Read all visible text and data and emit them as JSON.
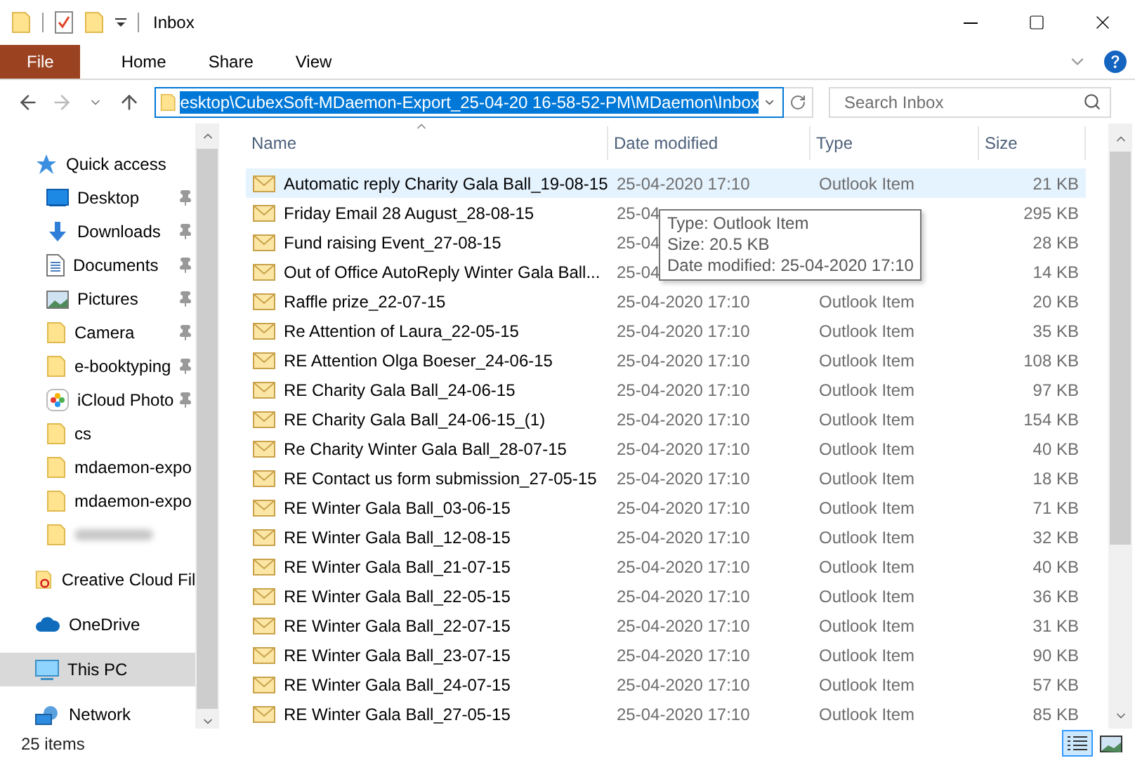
{
  "window": {
    "title": "Inbox"
  },
  "ribbon": {
    "tabs": [
      {
        "label": "File",
        "kind": "file",
        "selected": false
      },
      {
        "label": "Home",
        "kind": "tab",
        "selected": false
      },
      {
        "label": "Share",
        "kind": "tab",
        "selected": false
      },
      {
        "label": "View",
        "kind": "tab",
        "selected": false
      }
    ]
  },
  "address_bar": {
    "path": "esktop\\CubexSoft-MDaemon-Export_25-04-20 16-58-52-PM\\MDaemon\\Inbox",
    "text_selected": true
  },
  "search": {
    "placeholder": "Search Inbox"
  },
  "sidebar": {
    "items": [
      {
        "label": "Quick access",
        "kind": "star",
        "selected": false,
        "children": [
          {
            "label": "Desktop",
            "kind": "desktop",
            "pinned": true,
            "selected": false
          },
          {
            "label": "Downloads",
            "kind": "download",
            "pinned": true,
            "selected": false
          },
          {
            "label": "Documents",
            "kind": "document",
            "pinned": true,
            "selected": false
          },
          {
            "label": "Pictures",
            "kind": "pictures",
            "pinned": true,
            "selected": false
          },
          {
            "label": "Camera",
            "kind": "folder",
            "pinned": true,
            "selected": false
          },
          {
            "label": "e-booktyping",
            "kind": "folder",
            "pinned": true,
            "selected": false
          },
          {
            "label": "iCloud Photo",
            "kind": "photos",
            "pinned": true,
            "selected": false
          },
          {
            "label": "cs",
            "kind": "folder",
            "pinned": false,
            "selected": false
          },
          {
            "label": "mdaemon-expo",
            "kind": "folder",
            "pinned": false,
            "selected": false
          },
          {
            "label": "mdaemon-expo",
            "kind": "folder",
            "pinned": false,
            "selected": false
          },
          {
            "kind": "folder",
            "redacted": true,
            "pinned": false,
            "selected": false
          }
        ]
      },
      {
        "label": "Creative Cloud Fil",
        "kind": "creative",
        "selected": false
      },
      {
        "label": "OneDrive",
        "kind": "cloud",
        "selected": false
      },
      {
        "label": "This PC",
        "kind": "pc",
        "selected": true
      },
      {
        "label": "Network",
        "kind": "network",
        "selected": false
      }
    ]
  },
  "table": {
    "columns": [
      "Name",
      "Date modified",
      "Type",
      "Size"
    ],
    "rows": [
      {
        "name": "Automatic reply Charity Gala Ball_19-08-15",
        "date": "25-04-2020 17:10",
        "type": "Outlook Item",
        "size": "21 KB",
        "selected": true
      },
      {
        "name": "Friday Email 28 August_28-08-15",
        "date": "25-04",
        "size": "295 KB",
        "selected": false
      },
      {
        "name": "Fund raising Event_27-08-15",
        "date": "25-04",
        "size": "28 KB",
        "selected": false
      },
      {
        "name": "Out of Office AutoReply Winter Gala Ball...",
        "date": "25-04",
        "size": "14 KB",
        "selected": false
      },
      {
        "name": "Raffle prize_22-07-15",
        "date": "25-04-2020 17:10",
        "type": "Outlook Item",
        "size": "20 KB",
        "selected": false
      },
      {
        "name": "Re Attention of Laura_22-05-15",
        "date": "25-04-2020 17:10",
        "type": "Outlook Item",
        "size": "35 KB",
        "selected": false
      },
      {
        "name": "RE Attention Olga Boeser_24-06-15",
        "date": "25-04-2020 17:10",
        "type": "Outlook Item",
        "size": "108 KB",
        "selected": false
      },
      {
        "name": "RE Charity Gala Ball_24-06-15",
        "date": "25-04-2020 17:10",
        "type": "Outlook Item",
        "size": "97 KB",
        "selected": false
      },
      {
        "name": "RE Charity Gala Ball_24-06-15_(1)",
        "date": "25-04-2020 17:10",
        "type": "Outlook Item",
        "size": "154 KB",
        "selected": false
      },
      {
        "name": "Re Charity Winter Gala Ball_28-07-15",
        "date": "25-04-2020 17:10",
        "type": "Outlook Item",
        "size": "40 KB",
        "selected": false
      },
      {
        "name": "RE Contact us form submission_27-05-15",
        "date": "25-04-2020 17:10",
        "type": "Outlook Item",
        "size": "18 KB",
        "selected": false
      },
      {
        "name": "RE Winter Gala Ball_03-06-15",
        "date": "25-04-2020 17:10",
        "type": "Outlook Item",
        "size": "71 KB",
        "selected": false
      },
      {
        "name": "RE Winter Gala Ball_12-08-15",
        "date": "25-04-2020 17:10",
        "type": "Outlook Item",
        "size": "32 KB",
        "selected": false
      },
      {
        "name": "RE Winter Gala Ball_21-07-15",
        "date": "25-04-2020 17:10",
        "type": "Outlook Item",
        "size": "40 KB",
        "selected": false
      },
      {
        "name": "RE Winter Gala Ball_22-05-15",
        "date": "25-04-2020 17:10",
        "type": "Outlook Item",
        "size": "36 KB",
        "selected": false
      },
      {
        "name": "RE Winter Gala Ball_22-07-15",
        "date": "25-04-2020 17:10",
        "type": "Outlook Item",
        "size": "31 KB",
        "selected": false
      },
      {
        "name": "RE Winter Gala Ball_23-07-15",
        "date": "25-04-2020 17:10",
        "type": "Outlook Item",
        "size": "90 KB",
        "selected": false
      },
      {
        "name": "RE Winter Gala Ball_24-07-15",
        "date": "25-04-2020 17:10",
        "type": "Outlook Item",
        "size": "57 KB",
        "selected": false
      },
      {
        "name": "RE Winter Gala Ball_27-05-15",
        "date": "25-04-2020 17:10",
        "type": "Outlook Item",
        "size": "85 KB",
        "selected": false
      }
    ]
  },
  "tooltip": {
    "lines": [
      "Type: Outlook Item",
      "Size: 20.5 KB",
      "Date modified: 25-04-2020 17:10"
    ]
  },
  "status_bar": {
    "item_count": "25 items",
    "views": [
      {
        "kind": "details",
        "selected": true
      },
      {
        "kind": "thumbnails",
        "selected": false
      }
    ]
  }
}
